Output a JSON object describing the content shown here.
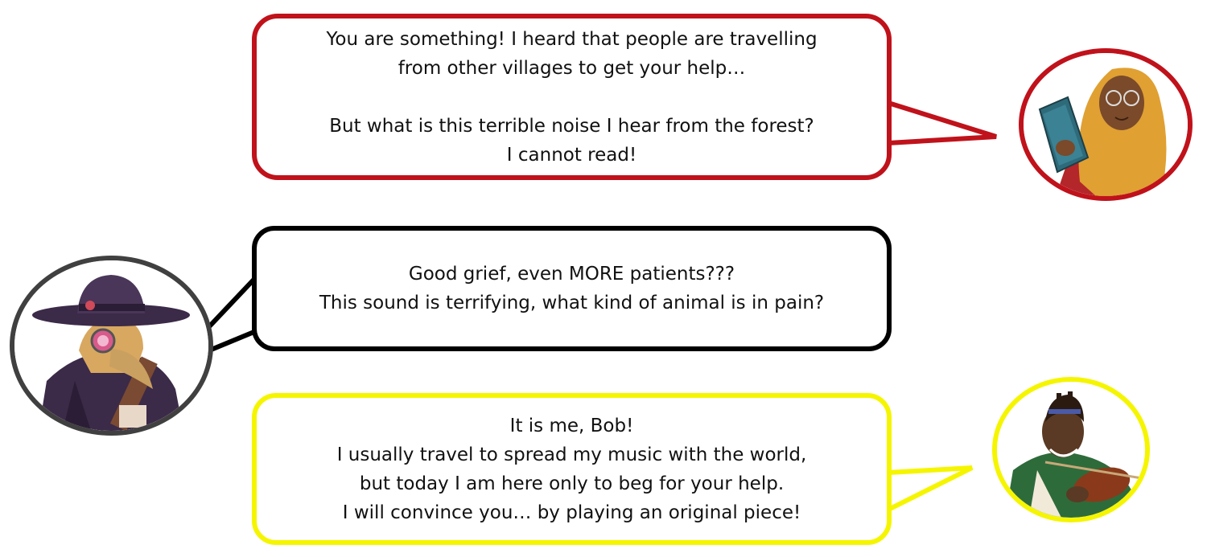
{
  "dialogue": [
    {
      "speaker_icon": "reading-woman-portrait",
      "border_color": "#c0121b",
      "lines": [
        "You are something! I heard that people are travelling",
        "from other villages to get your help…",
        "",
        "But what is this terrible noise I hear from the forest?",
        "I cannot read!"
      ]
    },
    {
      "speaker_icon": "plague-doctor-portrait",
      "border_color": "#000000",
      "lines": [
        "Good grief, even MORE patients???",
        "This sound is terrifying, what kind of animal is in pain?"
      ]
    },
    {
      "speaker_icon": "violinist-bob-portrait",
      "border_color": "#f5f500",
      "lines": [
        "It is me, Bob!",
        "I usually travel to spread my music with the world,",
        "but today I am here only to beg for your help.",
        "I will convince you… by playing an original piece!"
      ]
    }
  ]
}
